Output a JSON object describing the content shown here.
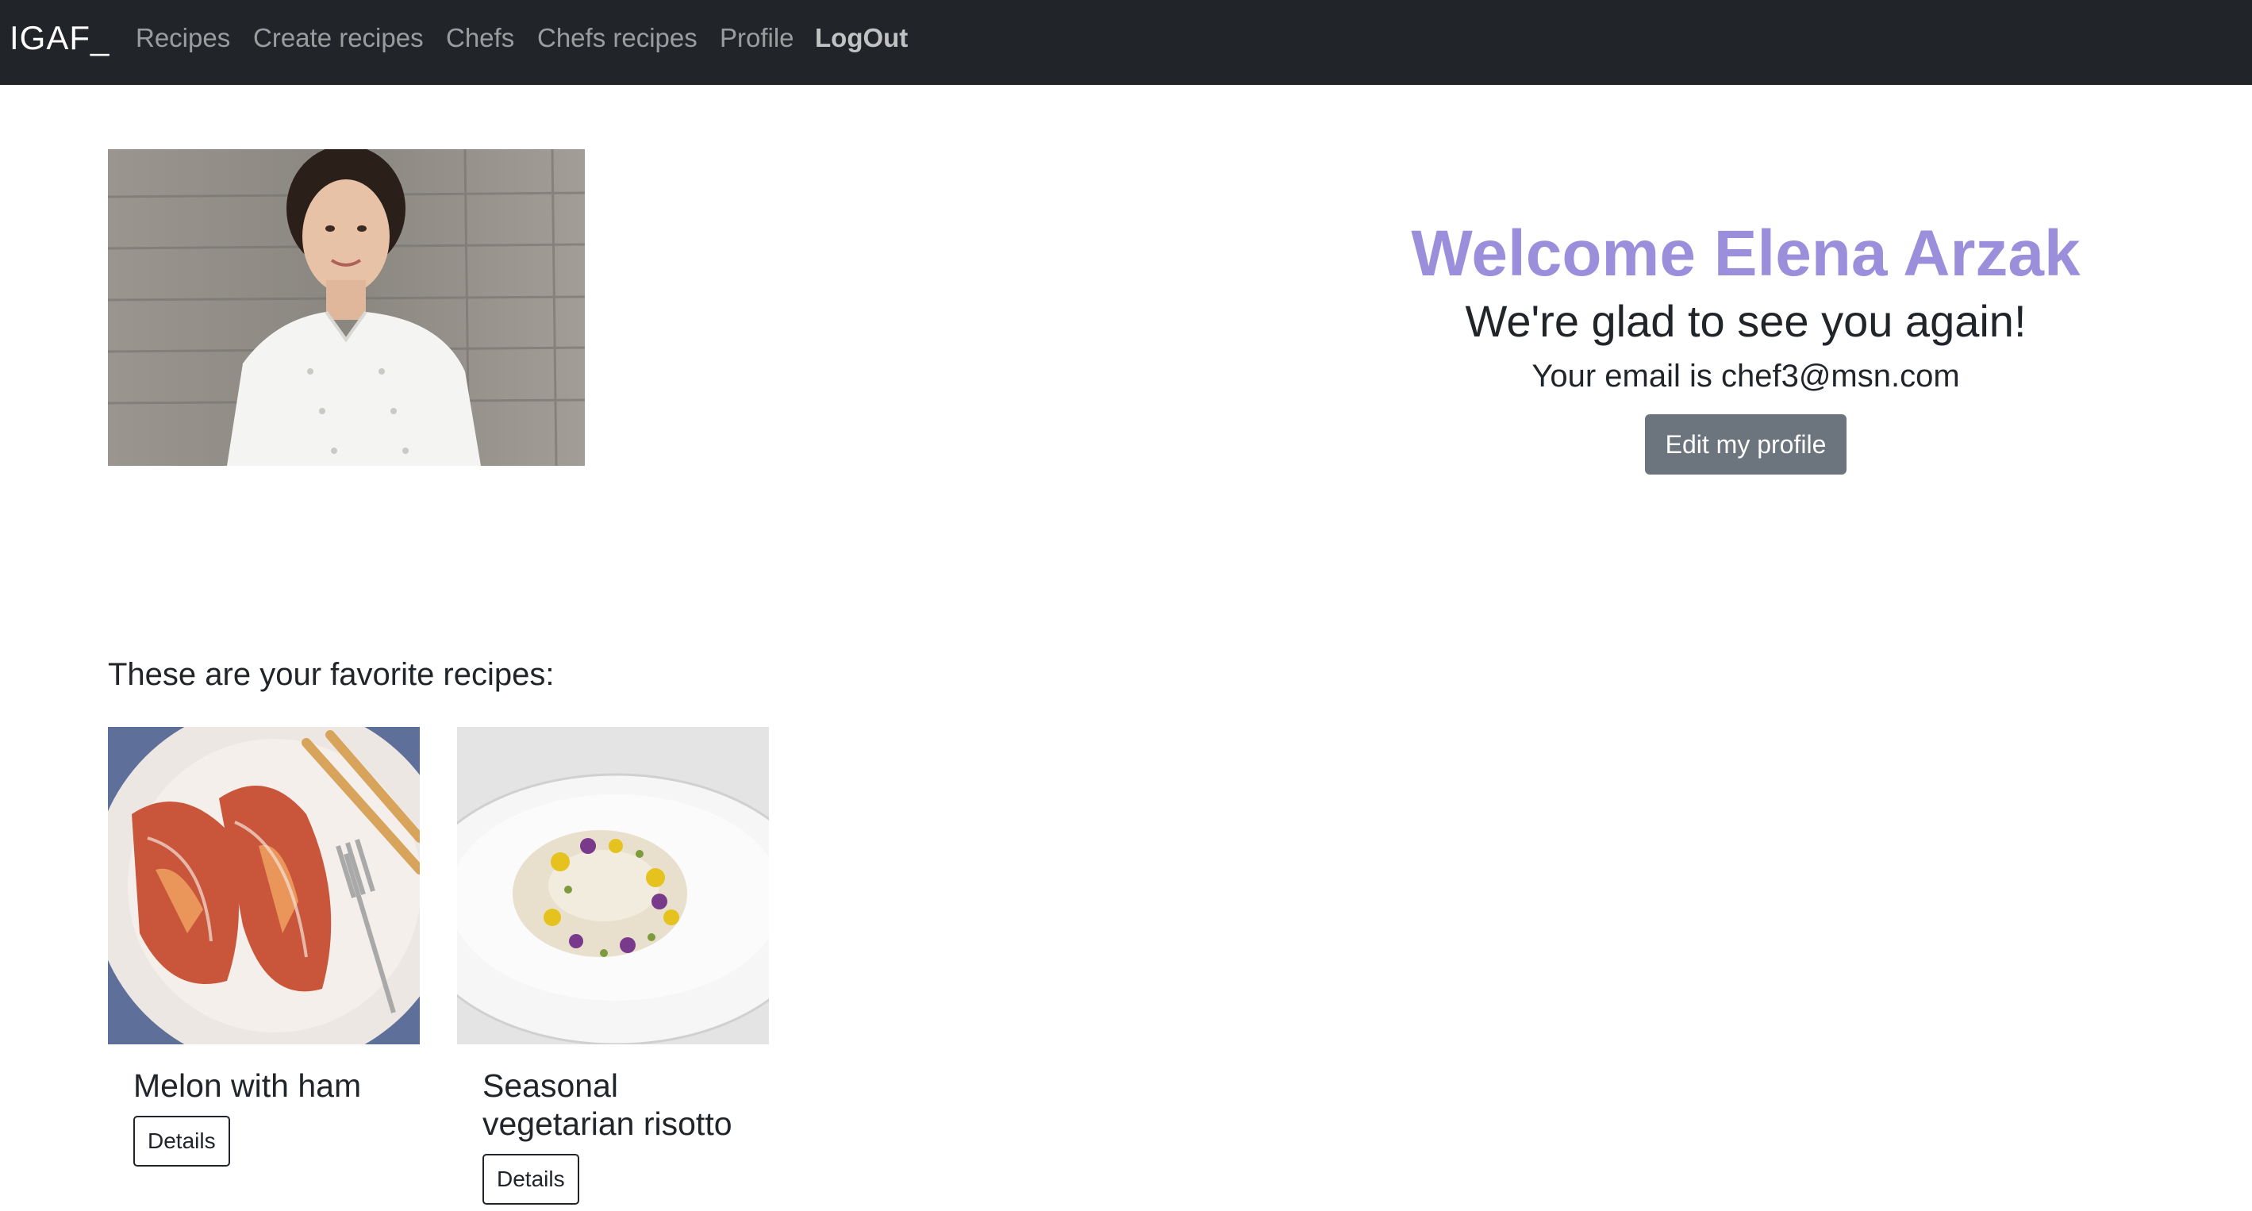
{
  "navbar": {
    "brand": "IGAF_",
    "links": [
      "Recipes",
      "Create recipes",
      "Chefs",
      "Chefs recipes",
      "Profile",
      "LogOut"
    ]
  },
  "profile": {
    "title": "Welcome Elena Arzak",
    "subtitle": "We're glad to see you again!",
    "email_line": "Your email is chef3@msn.com",
    "edit_button": "Edit my profile"
  },
  "favorites": {
    "heading": "These are your favorite recipes:",
    "recipes": [
      {
        "title": "Melon with ham",
        "button": "Details"
      },
      {
        "title": "Seasonal vegetarian risotto",
        "button": "Details"
      }
    ]
  },
  "colors": {
    "navbar_bg": "#212529",
    "accent": "#9b8fdc",
    "secondary_button": "#6c757d"
  }
}
